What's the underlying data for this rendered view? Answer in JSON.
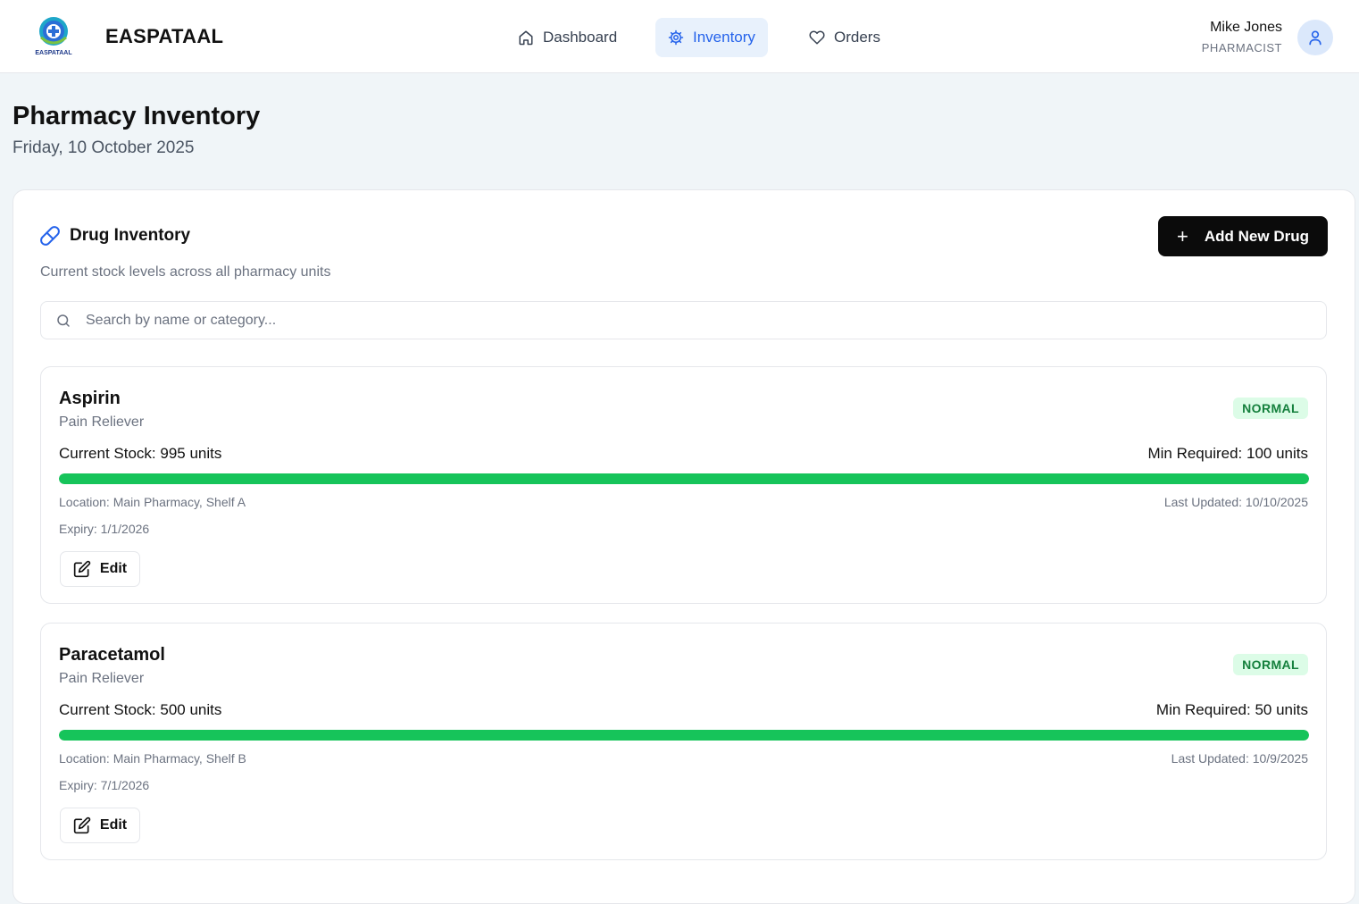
{
  "header": {
    "brand": "EASPATAAL",
    "logo_text": "EASPATAAL",
    "nav": [
      {
        "label": "Dashboard",
        "icon": "home-icon",
        "active": false
      },
      {
        "label": "Inventory",
        "icon": "gear-icon",
        "active": true
      },
      {
        "label": "Orders",
        "icon": "heart-icon",
        "active": false
      }
    ],
    "user": {
      "name": "Mike Jones",
      "role": "PHARMACIST",
      "icon": "user-icon"
    }
  },
  "page": {
    "title": "Pharmacy Inventory",
    "date": "Friday, 10 October 2025"
  },
  "inventory": {
    "title": "Drug Inventory",
    "title_icon": "pill-icon",
    "subtitle": "Current stock levels across all pharmacy units",
    "add_button": "Add New Drug",
    "search_placeholder": "Search by name or category..."
  },
  "drugs": [
    {
      "name": "Aspirin",
      "category": "Pain Reliever",
      "status": "NORMAL",
      "stock": "Current Stock: 995 units",
      "min_required": "Min Required: 100 units",
      "stock_fraction": 1.0,
      "location": "Location: Main Pharmacy, Shelf A",
      "last_updated": "Last Updated: 10/10/2025",
      "expiry": "Expiry: 1/1/2026",
      "edit_label": "Edit"
    },
    {
      "name": "Paracetamol",
      "category": "Pain Reliever",
      "status": "NORMAL",
      "stock": "Current Stock: 500 units",
      "min_required": "Min Required: 50 units",
      "stock_fraction": 1.0,
      "location": "Location: Main Pharmacy, Shelf B",
      "last_updated": "Last Updated: 10/9/2025",
      "expiry": "Expiry: 7/1/2026",
      "edit_label": "Edit"
    }
  ],
  "colors": {
    "accent": "#2563eb",
    "status_normal_bg": "#dcfce7",
    "status_normal_text": "#15803d",
    "stock_bar": "#16c45a",
    "primary_button": "#0b0b0b"
  }
}
